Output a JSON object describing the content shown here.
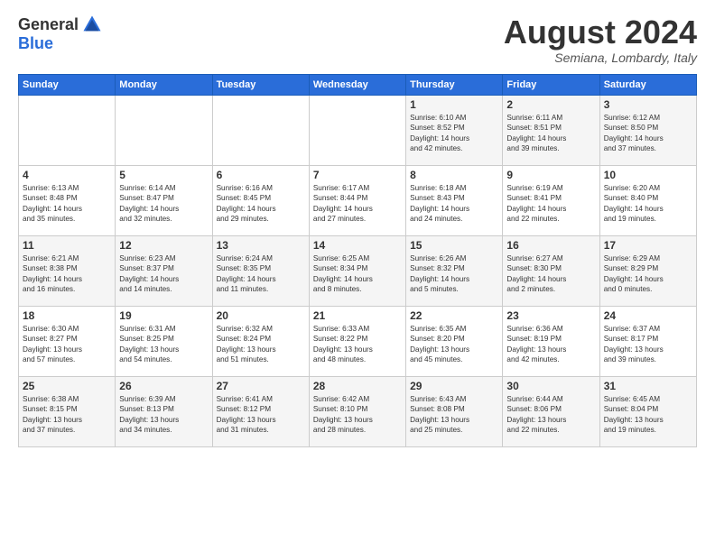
{
  "header": {
    "logo": {
      "general": "General",
      "blue": "Blue"
    },
    "title": "August 2024",
    "location": "Semiana, Lombardy, Italy"
  },
  "weekdays": [
    "Sunday",
    "Monday",
    "Tuesday",
    "Wednesday",
    "Thursday",
    "Friday",
    "Saturday"
  ],
  "weeks": [
    [
      {
        "day": "",
        "info": ""
      },
      {
        "day": "",
        "info": ""
      },
      {
        "day": "",
        "info": ""
      },
      {
        "day": "",
        "info": ""
      },
      {
        "day": "1",
        "info": "Sunrise: 6:10 AM\nSunset: 8:52 PM\nDaylight: 14 hours\nand 42 minutes."
      },
      {
        "day": "2",
        "info": "Sunrise: 6:11 AM\nSunset: 8:51 PM\nDaylight: 14 hours\nand 39 minutes."
      },
      {
        "day": "3",
        "info": "Sunrise: 6:12 AM\nSunset: 8:50 PM\nDaylight: 14 hours\nand 37 minutes."
      }
    ],
    [
      {
        "day": "4",
        "info": "Sunrise: 6:13 AM\nSunset: 8:48 PM\nDaylight: 14 hours\nand 35 minutes."
      },
      {
        "day": "5",
        "info": "Sunrise: 6:14 AM\nSunset: 8:47 PM\nDaylight: 14 hours\nand 32 minutes."
      },
      {
        "day": "6",
        "info": "Sunrise: 6:16 AM\nSunset: 8:45 PM\nDaylight: 14 hours\nand 29 minutes."
      },
      {
        "day": "7",
        "info": "Sunrise: 6:17 AM\nSunset: 8:44 PM\nDaylight: 14 hours\nand 27 minutes."
      },
      {
        "day": "8",
        "info": "Sunrise: 6:18 AM\nSunset: 8:43 PM\nDaylight: 14 hours\nand 24 minutes."
      },
      {
        "day": "9",
        "info": "Sunrise: 6:19 AM\nSunset: 8:41 PM\nDaylight: 14 hours\nand 22 minutes."
      },
      {
        "day": "10",
        "info": "Sunrise: 6:20 AM\nSunset: 8:40 PM\nDaylight: 14 hours\nand 19 minutes."
      }
    ],
    [
      {
        "day": "11",
        "info": "Sunrise: 6:21 AM\nSunset: 8:38 PM\nDaylight: 14 hours\nand 16 minutes."
      },
      {
        "day": "12",
        "info": "Sunrise: 6:23 AM\nSunset: 8:37 PM\nDaylight: 14 hours\nand 14 minutes."
      },
      {
        "day": "13",
        "info": "Sunrise: 6:24 AM\nSunset: 8:35 PM\nDaylight: 14 hours\nand 11 minutes."
      },
      {
        "day": "14",
        "info": "Sunrise: 6:25 AM\nSunset: 8:34 PM\nDaylight: 14 hours\nand 8 minutes."
      },
      {
        "day": "15",
        "info": "Sunrise: 6:26 AM\nSunset: 8:32 PM\nDaylight: 14 hours\nand 5 minutes."
      },
      {
        "day": "16",
        "info": "Sunrise: 6:27 AM\nSunset: 8:30 PM\nDaylight: 14 hours\nand 2 minutes."
      },
      {
        "day": "17",
        "info": "Sunrise: 6:29 AM\nSunset: 8:29 PM\nDaylight: 14 hours\nand 0 minutes."
      }
    ],
    [
      {
        "day": "18",
        "info": "Sunrise: 6:30 AM\nSunset: 8:27 PM\nDaylight: 13 hours\nand 57 minutes."
      },
      {
        "day": "19",
        "info": "Sunrise: 6:31 AM\nSunset: 8:25 PM\nDaylight: 13 hours\nand 54 minutes."
      },
      {
        "day": "20",
        "info": "Sunrise: 6:32 AM\nSunset: 8:24 PM\nDaylight: 13 hours\nand 51 minutes."
      },
      {
        "day": "21",
        "info": "Sunrise: 6:33 AM\nSunset: 8:22 PM\nDaylight: 13 hours\nand 48 minutes."
      },
      {
        "day": "22",
        "info": "Sunrise: 6:35 AM\nSunset: 8:20 PM\nDaylight: 13 hours\nand 45 minutes."
      },
      {
        "day": "23",
        "info": "Sunrise: 6:36 AM\nSunset: 8:19 PM\nDaylight: 13 hours\nand 42 minutes."
      },
      {
        "day": "24",
        "info": "Sunrise: 6:37 AM\nSunset: 8:17 PM\nDaylight: 13 hours\nand 39 minutes."
      }
    ],
    [
      {
        "day": "25",
        "info": "Sunrise: 6:38 AM\nSunset: 8:15 PM\nDaylight: 13 hours\nand 37 minutes."
      },
      {
        "day": "26",
        "info": "Sunrise: 6:39 AM\nSunset: 8:13 PM\nDaylight: 13 hours\nand 34 minutes."
      },
      {
        "day": "27",
        "info": "Sunrise: 6:41 AM\nSunset: 8:12 PM\nDaylight: 13 hours\nand 31 minutes."
      },
      {
        "day": "28",
        "info": "Sunrise: 6:42 AM\nSunset: 8:10 PM\nDaylight: 13 hours\nand 28 minutes."
      },
      {
        "day": "29",
        "info": "Sunrise: 6:43 AM\nSunset: 8:08 PM\nDaylight: 13 hours\nand 25 minutes."
      },
      {
        "day": "30",
        "info": "Sunrise: 6:44 AM\nSunset: 8:06 PM\nDaylight: 13 hours\nand 22 minutes."
      },
      {
        "day": "31",
        "info": "Sunrise: 6:45 AM\nSunset: 8:04 PM\nDaylight: 13 hours\nand 19 minutes."
      }
    ]
  ]
}
